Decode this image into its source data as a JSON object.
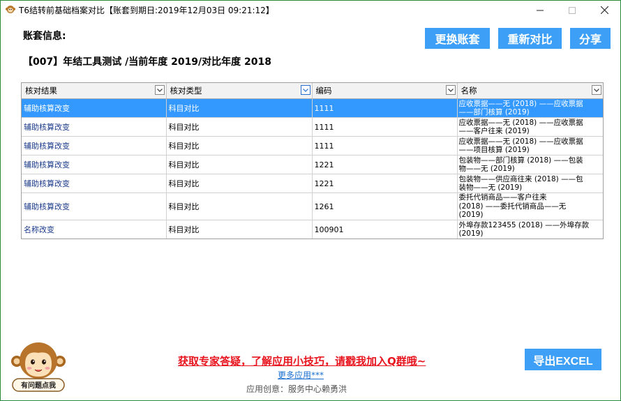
{
  "window": {
    "title": "T6结转前基础档案对比【账套到期日:2019年12月03日 09:21:12】"
  },
  "header": {
    "account_label": "账套信息:",
    "account_value": "【007】年结工具测试 /当前年度 2019/对比年度 2018",
    "buttons": {
      "change_account": "更换账套",
      "recompare": "重新对比",
      "share": "分享"
    }
  },
  "grid": {
    "columns": [
      "核对结果",
      "核对类型",
      "编码",
      "名称"
    ],
    "rows": [
      {
        "result": "辅助核算改变",
        "type": "科目对比",
        "code": "1111",
        "name_lines": [
          "应收票据——无 (2018) ——应收票据",
          "——部门核算 (2019)"
        ],
        "selected": true
      },
      {
        "result": "辅助核算改变",
        "type": "科目对比",
        "code": "1111",
        "name_lines": [
          "应收票据——无 (2018) ——应收票据",
          "——客户往来 (2019)"
        ]
      },
      {
        "result": "辅助核算改变",
        "type": "科目对比",
        "code": "1111",
        "name_lines": [
          "应收票据——无 (2018) ——应收票据",
          "——项目核算 (2019)"
        ]
      },
      {
        "result": "辅助核算改变",
        "type": "科目对比",
        "code": "1221",
        "name_lines": [
          "包装物——部门核算 (2018) ——包装",
          "物——无 (2019)"
        ]
      },
      {
        "result": "辅助核算改变",
        "type": "科目对比",
        "code": "1221",
        "name_lines": [
          "包装物——供应商往来 (2018) ——包",
          "装物——无 (2019)"
        ]
      },
      {
        "result": "辅助核算改变",
        "type": "科目对比",
        "code": "1261",
        "name_lines": [
          "委托代销商品——客户往来",
          "(2018) ——委托代销商品——无",
          "(2019)"
        ]
      },
      {
        "result": "名称改变",
        "type": "科目对比",
        "code": "100901",
        "name_lines": [
          "外埠存款123455 (2018) ——外埠存款",
          "(2019)"
        ]
      }
    ]
  },
  "footer": {
    "mascot_caption": "有问题点我",
    "promo_text": "获取专家答疑，了解应用小技巧，请戳我加入Q群哦~",
    "more_apps": "更多应用***",
    "credit": "应用创意：服务中心赖勇洪",
    "export_button": "导出EXCEL"
  },
  "colors": {
    "accent": "#3d9ff5",
    "selected_row": "#3399ff",
    "promo": "#e8141e",
    "link": "#1a6fd0"
  }
}
